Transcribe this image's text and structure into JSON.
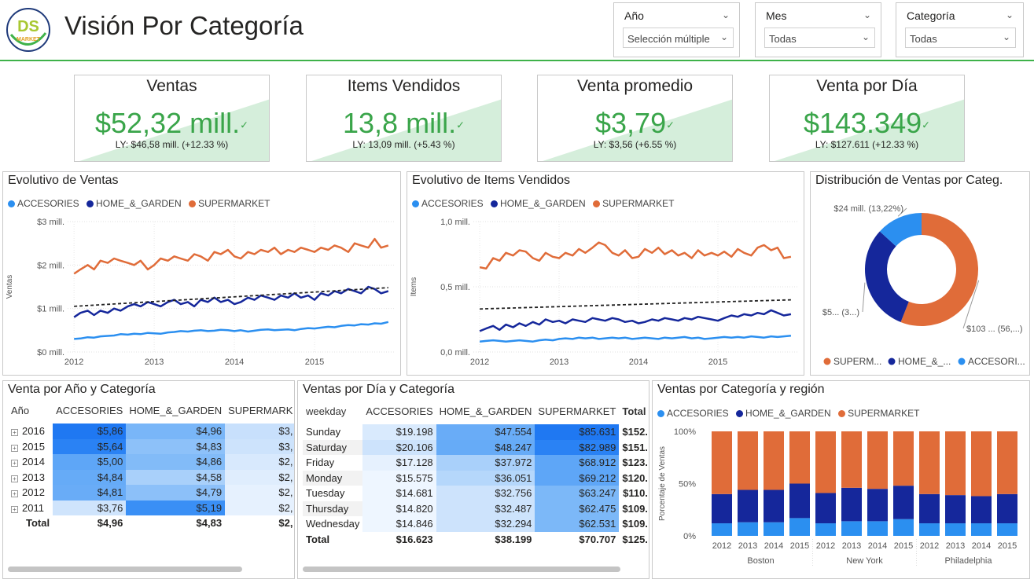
{
  "header": {
    "logo_text": "DS",
    "logo_sub": "MARKET",
    "title": "Visión Por Categoría"
  },
  "slicers": [
    {
      "label": "Año",
      "value": "Selección múltiple"
    },
    {
      "label": "Mes",
      "value": "Todas"
    },
    {
      "label": "Categoría",
      "value": "Todas"
    }
  ],
  "kpis": [
    {
      "title": "Ventas",
      "value": "$52,32 mill.",
      "ly": "LY: $46,58 mill. (+12.33 %)"
    },
    {
      "title": "Items Vendidos",
      "value": "13,8 mill.",
      "ly": "LY: 13,09 mill. (+5.43 %)"
    },
    {
      "title": "Venta promedio",
      "value": "$3,79",
      "ly": "LY: $3,56 (+6.55 %)"
    },
    {
      "title": "Venta por Día",
      "value": "$143.349",
      "ly": "LY: $127.611 (+12.33 %)"
    }
  ],
  "colors": {
    "accesories": "#2b8ff0",
    "home_garden": "#15279b",
    "supermarket": "#e06c39",
    "kpi_green": "#3aa54a",
    "header_line": "#3fb24a"
  },
  "categories": [
    "ACCESORIES",
    "HOME_&_GARDEN",
    "SUPERMARKET"
  ],
  "chart_data": [
    {
      "type": "line",
      "title": "Evolutivo de Ventas",
      "ylabel": "Ventas",
      "ylim": [
        0,
        3000000
      ],
      "yticks": [
        "$0 mill.",
        "$1 mill.",
        "$2 mill.",
        "$3 mill."
      ],
      "xticks": [
        "2012",
        "2013",
        "2014",
        "2015"
      ],
      "x": [
        2012.0,
        2012.08,
        2012.17,
        2012.25,
        2012.33,
        2012.42,
        2012.5,
        2012.58,
        2012.67,
        2012.75,
        2012.83,
        2012.92,
        2013.0,
        2013.08,
        2013.17,
        2013.25,
        2013.33,
        2013.42,
        2013.5,
        2013.58,
        2013.67,
        2013.75,
        2013.83,
        2013.92,
        2014.0,
        2014.08,
        2014.17,
        2014.25,
        2014.33,
        2014.42,
        2014.5,
        2014.58,
        2014.67,
        2014.75,
        2014.83,
        2014.92,
        2015.0,
        2015.08,
        2015.17,
        2015.25,
        2015.33,
        2015.42,
        2015.5,
        2015.58,
        2015.67,
        2015.75,
        2015.83,
        2015.92
      ],
      "series": [
        {
          "name": "ACCESORIES",
          "values": [
            300000,
            310000,
            340000,
            330000,
            360000,
            370000,
            380000,
            410000,
            400000,
            420000,
            410000,
            440000,
            430000,
            420000,
            450000,
            460000,
            480000,
            470000,
            490000,
            500000,
            480000,
            490000,
            510000,
            500000,
            480000,
            500000,
            470000,
            490000,
            510000,
            520000,
            500000,
            510000,
            520000,
            500000,
            530000,
            550000,
            540000,
            560000,
            580000,
            570000,
            600000,
            620000,
            610000,
            640000,
            630000,
            660000,
            650000,
            690000
          ]
        },
        {
          "name": "HOME_&_GARDEN",
          "values": [
            800000,
            900000,
            950000,
            850000,
            950000,
            900000,
            1000000,
            950000,
            1050000,
            1100000,
            1050000,
            1150000,
            1100000,
            1050000,
            1150000,
            1200000,
            1100000,
            1150000,
            1050000,
            1200000,
            1150000,
            1250000,
            1150000,
            1200000,
            1100000,
            1150000,
            1250000,
            1200000,
            1300000,
            1250000,
            1200000,
            1300000,
            1250000,
            1350000,
            1250000,
            1300000,
            1200000,
            1350000,
            1300000,
            1400000,
            1350000,
            1450000,
            1400000,
            1350000,
            1500000,
            1450000,
            1350000,
            1400000
          ]
        },
        {
          "name": "SUPERMARKET",
          "values": [
            1800000,
            1900000,
            2000000,
            1900000,
            2100000,
            2050000,
            2150000,
            2100000,
            2050000,
            2000000,
            2100000,
            1900000,
            2000000,
            2150000,
            2100000,
            2200000,
            2150000,
            2100000,
            2250000,
            2200000,
            2100000,
            2300000,
            2250000,
            2350000,
            2200000,
            2150000,
            2300000,
            2250000,
            2350000,
            2300000,
            2400000,
            2250000,
            2350000,
            2300000,
            2400000,
            2350000,
            2300000,
            2400000,
            2350000,
            2450000,
            2400000,
            2300000,
            2500000,
            2450000,
            2400000,
            2600000,
            2400000,
            2450000
          ]
        }
      ],
      "trend": [
        [
          2012.0,
          1050000
        ],
        [
          2015.92,
          1480000
        ]
      ]
    },
    {
      "type": "line",
      "title": "Evolutivo de Items Vendidos",
      "ylabel": "Items",
      "ylim": [
        0,
        1000000
      ],
      "yticks": [
        "0,0 mill.",
        "0,5 mill.",
        "1,0 mill."
      ],
      "xticks": [
        "2012",
        "2013",
        "2014",
        "2015"
      ],
      "x": [
        2012.0,
        2012.08,
        2012.17,
        2012.25,
        2012.33,
        2012.42,
        2012.5,
        2012.58,
        2012.67,
        2012.75,
        2012.83,
        2012.92,
        2013.0,
        2013.08,
        2013.17,
        2013.25,
        2013.33,
        2013.42,
        2013.5,
        2013.58,
        2013.67,
        2013.75,
        2013.83,
        2013.92,
        2014.0,
        2014.08,
        2014.17,
        2014.25,
        2014.33,
        2014.42,
        2014.5,
        2014.58,
        2014.67,
        2014.75,
        2014.83,
        2014.92,
        2015.0,
        2015.08,
        2015.17,
        2015.25,
        2015.33,
        2015.42,
        2015.5,
        2015.58,
        2015.67,
        2015.75,
        2015.83,
        2015.92
      ],
      "series": [
        {
          "name": "ACCESORIES",
          "values": [
            80000,
            85000,
            90000,
            85000,
            80000,
            85000,
            90000,
            85000,
            80000,
            90000,
            95000,
            90000,
            100000,
            105000,
            100000,
            110000,
            105000,
            110000,
            100000,
            105000,
            110000,
            105000,
            110000,
            100000,
            105000,
            110000,
            105000,
            100000,
            110000,
            105000,
            110000,
            115000,
            105000,
            110000,
            100000,
            105000,
            110000,
            115000,
            110000,
            115000,
            110000,
            120000,
            115000,
            110000,
            120000,
            115000,
            120000,
            125000
          ]
        },
        {
          "name": "HOME_&_GARDEN",
          "values": [
            160000,
            180000,
            200000,
            170000,
            210000,
            190000,
            220000,
            200000,
            230000,
            210000,
            250000,
            230000,
            240000,
            220000,
            250000,
            240000,
            230000,
            260000,
            250000,
            240000,
            260000,
            250000,
            230000,
            240000,
            220000,
            230000,
            250000,
            240000,
            260000,
            250000,
            240000,
            260000,
            250000,
            270000,
            260000,
            250000,
            240000,
            260000,
            280000,
            270000,
            290000,
            280000,
            300000,
            290000,
            320000,
            300000,
            280000,
            290000
          ]
        },
        {
          "name": "SUPERMARKET",
          "values": [
            650000,
            640000,
            720000,
            700000,
            760000,
            740000,
            780000,
            770000,
            720000,
            700000,
            760000,
            730000,
            720000,
            760000,
            740000,
            790000,
            760000,
            800000,
            840000,
            820000,
            760000,
            740000,
            780000,
            720000,
            730000,
            790000,
            760000,
            800000,
            750000,
            780000,
            740000,
            760000,
            720000,
            780000,
            740000,
            760000,
            740000,
            770000,
            730000,
            790000,
            760000,
            740000,
            800000,
            820000,
            780000,
            800000,
            720000,
            730000
          ]
        }
      ],
      "trend": [
        [
          2012.0,
          330000
        ],
        [
          2015.92,
          400000
        ]
      ]
    },
    {
      "type": "pie",
      "title": "Distribución de Ventas por Categ.",
      "labels": [
        "SUPERMARKET",
        "HOME_&_GARDEN",
        "ACCESORIES"
      ],
      "legend": [
        "SUPERM...",
        "HOME_&_...",
        "ACCESORI..."
      ],
      "values": [
        56.0,
        30.78,
        13.22
      ],
      "data_labels": [
        "$103 ... (56,...)",
        "$5... (3...)",
        "$24 mill. (13,22%)"
      ]
    },
    {
      "type": "bar",
      "title": "Ventas por Categoría y región",
      "ylabel": "Porcentaje de Ventas",
      "yticks": [
        "0%",
        "50%",
        "100%"
      ],
      "ylim": [
        0,
        100
      ],
      "stacked": true,
      "groups": [
        "Boston",
        "New York",
        "Philadelphia"
      ],
      "categories": [
        "2012",
        "2013",
        "2014",
        "2015",
        "2012",
        "2013",
        "2014",
        "2015",
        "2012",
        "2013",
        "2014",
        "2015"
      ],
      "series": [
        {
          "name": "ACCESORIES",
          "values": [
            12,
            13,
            13,
            17,
            12,
            14,
            14,
            16,
            12,
            12,
            12,
            12
          ]
        },
        {
          "name": "HOME_&_GARDEN",
          "values": [
            28,
            31,
            31,
            33,
            29,
            32,
            31,
            32,
            28,
            27,
            26,
            28
          ]
        },
        {
          "name": "SUPERMARKET",
          "values": [
            60,
            56,
            56,
            50,
            59,
            54,
            55,
            52,
            60,
            61,
            62,
            60
          ]
        }
      ]
    }
  ],
  "table_year": {
    "title": "Venta por Año y Categoría",
    "columns": [
      "Año",
      "ACCESORIES",
      "HOME_&_GARDEN",
      "SUPERMARK"
    ],
    "rows": [
      {
        "year": "2016",
        "a": "$5,86",
        "h": "$4,96",
        "s": "$3,"
      },
      {
        "year": "2015",
        "a": "$5,64",
        "h": "$4,83",
        "s": "$3,"
      },
      {
        "year": "2014",
        "a": "$5,00",
        "h": "$4,86",
        "s": "$2,"
      },
      {
        "year": "2013",
        "a": "$4,84",
        "h": "$4,58",
        "s": "$2,"
      },
      {
        "year": "2012",
        "a": "$4,81",
        "h": "$4,79",
        "s": "$2,"
      },
      {
        "year": "2011",
        "a": "$3,76",
        "h": "$5,19",
        "s": "$2,"
      }
    ],
    "total": {
      "label": "Total",
      "a": "$4,96",
      "h": "$4,83",
      "s": "$2,"
    }
  },
  "table_day": {
    "title": "Ventas por Día y Categoría",
    "columns": [
      "weekday",
      "ACCESORIES",
      "HOME_&_GARDEN",
      "SUPERMARKET",
      "Total"
    ],
    "rows": [
      {
        "day": "Sunday",
        "a": "$19.198",
        "h": "$47.554",
        "s": "$85.631",
        "t": "$152."
      },
      {
        "day": "Saturday",
        "a": "$20.106",
        "h": "$48.247",
        "s": "$82.989",
        "t": "$151."
      },
      {
        "day": "Friday",
        "a": "$17.128",
        "h": "$37.972",
        "s": "$68.912",
        "t": "$123."
      },
      {
        "day": "Monday",
        "a": "$15.575",
        "h": "$36.051",
        "s": "$69.212",
        "t": "$120."
      },
      {
        "day": "Tuesday",
        "a": "$14.681",
        "h": "$32.756",
        "s": "$63.247",
        "t": "$110."
      },
      {
        "day": "Thursday",
        "a": "$14.820",
        "h": "$32.487",
        "s": "$62.475",
        "t": "$109."
      },
      {
        "day": "Wednesday",
        "a": "$14.846",
        "h": "$32.294",
        "s": "$62.531",
        "t": "$109."
      }
    ],
    "total": {
      "label": "Total",
      "a": "$16.623",
      "h": "$38.199",
      "s": "$70.707",
      "t": "$125."
    }
  }
}
